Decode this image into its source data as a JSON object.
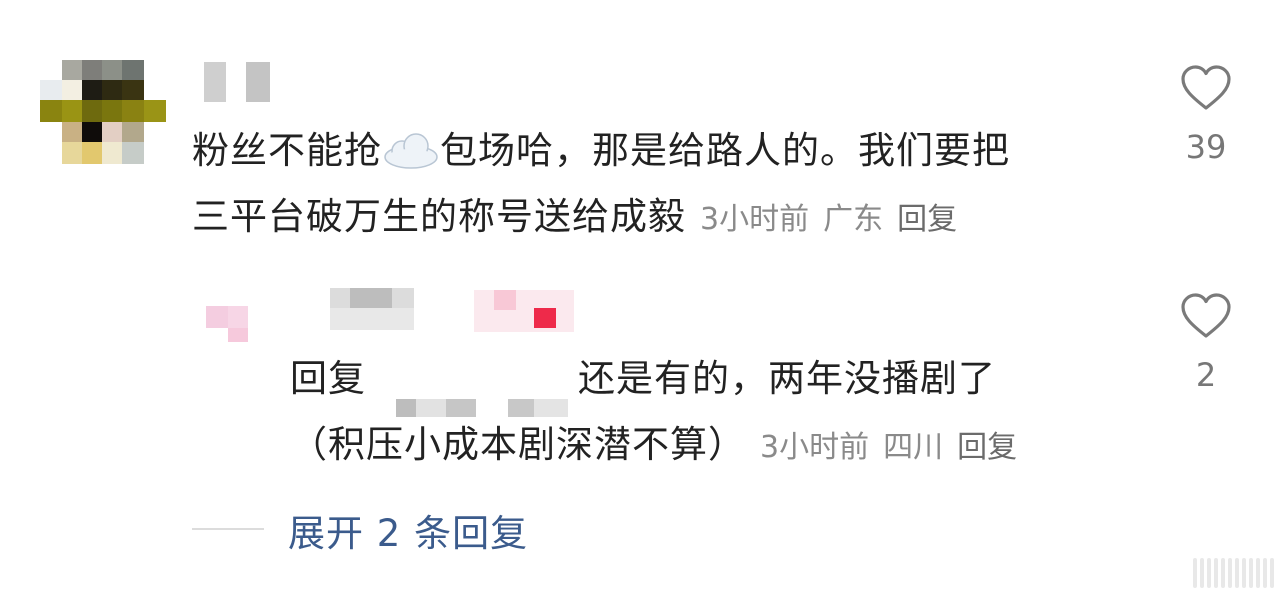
{
  "comments": [
    {
      "text_before_emoji": "粉丝不能抢",
      "text_after_emoji": "包场哈，那是给路人的。我们要把",
      "text_line2": "三平台破万生的称号送给成毅",
      "time": "3小时前",
      "location": "广东",
      "reply_label": "回复",
      "like_count": "39",
      "emoji": "cloud"
    }
  ],
  "replies": [
    {
      "prefix": "回复",
      "text_line1": "还是有的，两年没播剧了",
      "text_line2": "（积压小成本剧深潜不算）",
      "time": "3小时前",
      "location": "四川",
      "reply_label": "回复",
      "like_count": "2"
    }
  ],
  "expand": {
    "label": "展开 2 条回复"
  },
  "colors": {
    "link_blue": "#3b5b8c",
    "meta_gray": "#8a8a8a",
    "heart_outline": "#7a7a7a"
  }
}
